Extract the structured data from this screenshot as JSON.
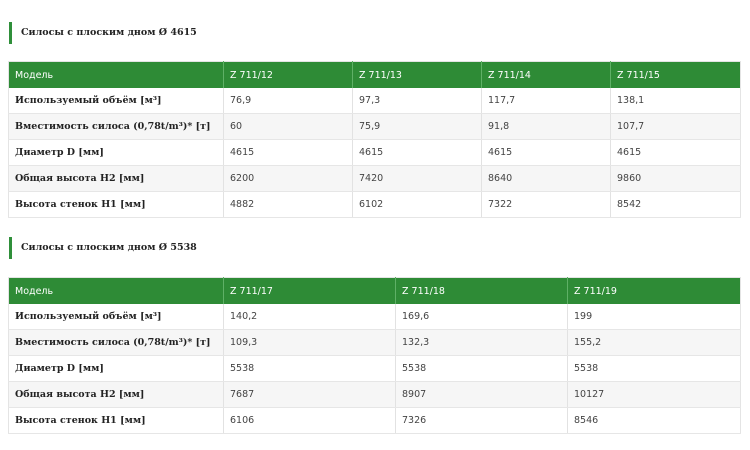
{
  "sections": [
    {
      "title": "Силосы с плоским дном Ø 4615",
      "header": [
        "Модель",
        "Z 711/12",
        "Z 711/13",
        "Z 711/14",
        "Z 711/15"
      ],
      "rows": [
        {
          "label": "Используемый объём [м³]",
          "values": [
            "76,9",
            "97,3",
            "117,7",
            "138,1"
          ]
        },
        {
          "label": "Вместимость силоса (0,78t/m³)* [т]",
          "values": [
            "60",
            "75,9",
            "91,8",
            "107,7"
          ]
        },
        {
          "label": "Диаметр D [мм]",
          "values": [
            "4615",
            "4615",
            "4615",
            "4615"
          ]
        },
        {
          "label": "Общая высота H2 [мм]",
          "values": [
            "6200",
            "7420",
            "8640",
            "9860"
          ]
        },
        {
          "label": "Высота стенок H1 [мм]",
          "values": [
            "4882",
            "6102",
            "7322",
            "8542"
          ]
        }
      ]
    },
    {
      "title": "Силосы с плоским дном Ø 5538",
      "header": [
        "Модель",
        "Z 711/17",
        "Z 711/18",
        "Z 711/19"
      ],
      "rows": [
        {
          "label": "Используемый объём [м³]",
          "values": [
            "140,2",
            "169,6",
            "199"
          ]
        },
        {
          "label": "Вместимость силоса (0,78t/m³)* [т]",
          "values": [
            "109,3",
            "132,3",
            "155,2"
          ]
        },
        {
          "label": "Диаметр D [мм]",
          "values": [
            "5538",
            "5538",
            "5538"
          ]
        },
        {
          "label": "Общая высота H2 [мм]",
          "values": [
            "7687",
            "8907",
            "10127"
          ]
        },
        {
          "label": "Высота стенок H1 [мм]",
          "values": [
            "6106",
            "7326",
            "8546"
          ]
        }
      ]
    }
  ],
  "colors": {
    "header_green": "#2e8b36",
    "accent_bar": "#2f8f3a",
    "stripe": "#f6f6f6"
  }
}
